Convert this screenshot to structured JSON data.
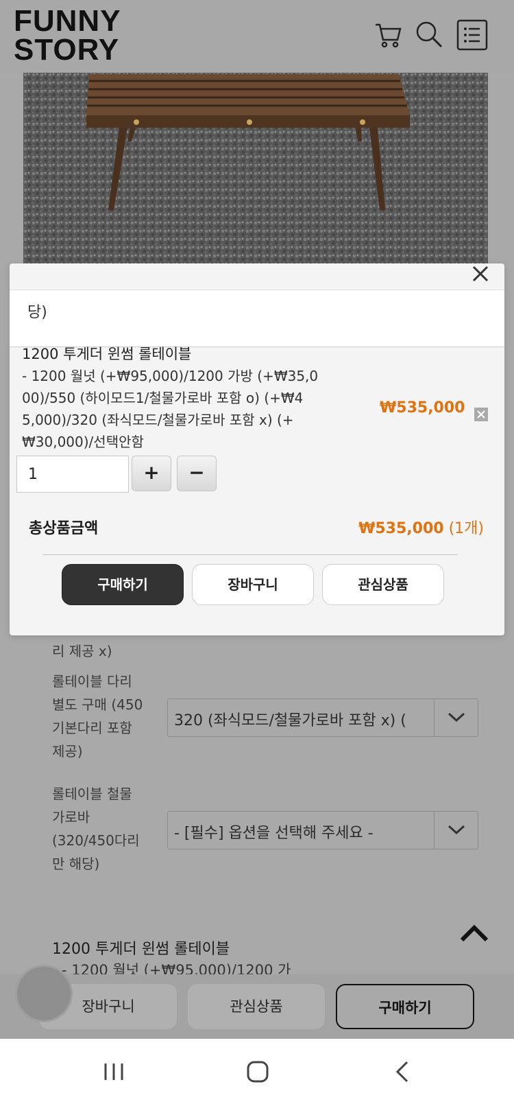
{
  "header": {
    "logo_line1": "FUNNY",
    "logo_line2": "STORY",
    "icons": [
      "cart-icon",
      "search-icon",
      "menu-icon"
    ]
  },
  "modal": {
    "cut_text": "당)",
    "selected_item": {
      "title": "1200 투게더 윈썸 롤테이블",
      "desc_lines": [
        "- 1200 월넛 (+₩95,000)/1200 가방 (+₩35,0",
        "00)/550 (하이모드1/철물가로바 포함 o) (+₩4",
        "5,000)/320 (좌식모드/철물가로바 포함 x) (+",
        "₩30,000)/선택안함"
      ],
      "price": "₩535,000",
      "quantity": "1"
    },
    "qty_plus": "+",
    "qty_minus": "−",
    "total_label": "총상품금액",
    "total_price": "₩535,000",
    "total_count": "(1개)",
    "buttons": {
      "buy": "구매하기",
      "cart": "장바구니",
      "wish": "관심상품"
    }
  },
  "background_page": {
    "partial_label": "리 제공 x)",
    "option_leg": {
      "label_lines": [
        "롤테이블 다리",
        "별도 구매 (450",
        "기본다리 포함",
        "제공)"
      ],
      "value": "320 (좌식모드/철물가로바 포함 x) ("
    },
    "option_bar": {
      "label_lines": [
        "롤테이블 철물",
        "가로바",
        "(320/450다리",
        "만 해당)"
      ],
      "value": "- [필수] 옵션을 선택해 주세요 -"
    },
    "item_title": "1200 투게더 윈썸 롤테이블",
    "item_line": "- 1200 월넛 (+₩95,000)/1200 가"
  },
  "bottom_bar": {
    "cart": "장바구니",
    "wish": "관심상품",
    "buy": "구매하기"
  },
  "colors": {
    "accent_price": "#e0730f",
    "primary_button": "#333333"
  }
}
